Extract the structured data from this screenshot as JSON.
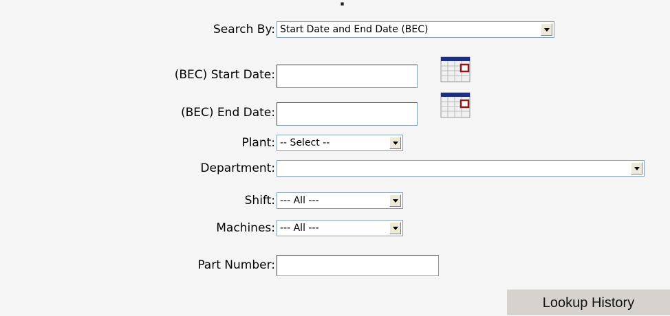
{
  "form": {
    "search_by": {
      "label": "Search By:",
      "selected": "Start Date and End Date (BEC)"
    },
    "start_date": {
      "label": "(BEC) Start Date:",
      "value": "",
      "calendar_icon": "calendar-icon"
    },
    "end_date": {
      "label": "(BEC) End Date:",
      "value": "",
      "calendar_icon": "calendar-icon"
    },
    "plant": {
      "label": "Plant:",
      "selected": "-- Select --"
    },
    "department": {
      "label": "Department:",
      "selected": ""
    },
    "shift": {
      "label": "Shift:",
      "selected": "--- All ---"
    },
    "machines": {
      "label": "Machines:",
      "selected": "--- All ---"
    },
    "part_number": {
      "label": "Part Number:",
      "value": ""
    }
  },
  "actions": {
    "lookup_label": "Lookup History"
  },
  "colors": {
    "page_bg": "#f5f5f5",
    "button_bg": "#d6d3ce",
    "input_border": "#7f9db9"
  }
}
